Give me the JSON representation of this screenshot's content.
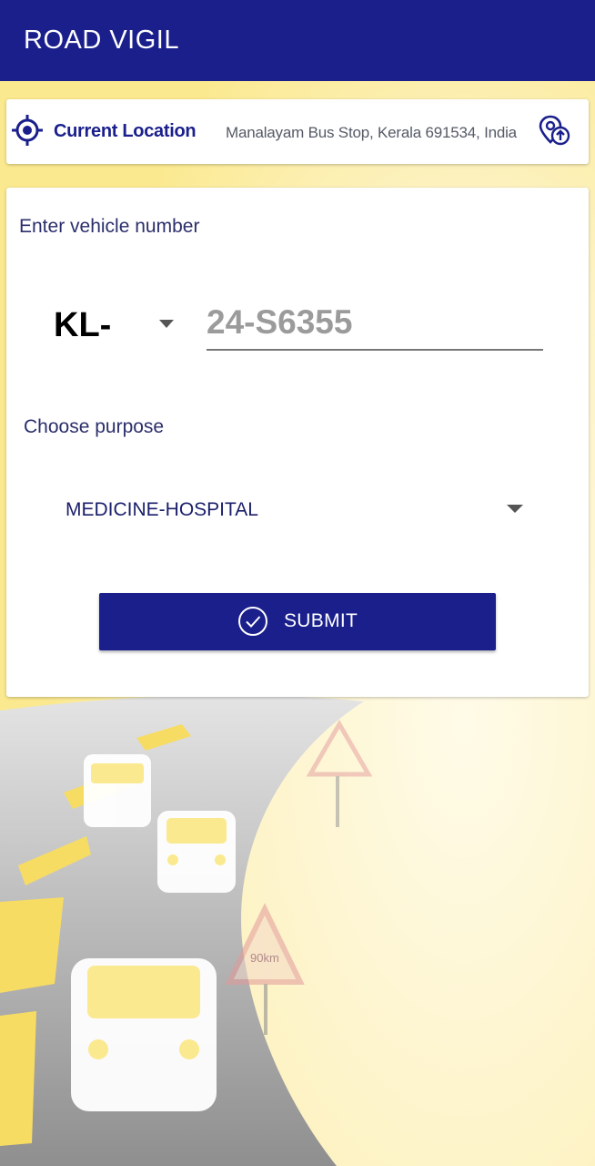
{
  "appbar": {
    "title": "ROAD VIGIL"
  },
  "location": {
    "label": "Current Location",
    "address": "Manalayam Bus Stop, Kerala 691534, India"
  },
  "form": {
    "vehicle_label": "Enter vehicle number",
    "state_prefix": "KL-",
    "vehicle_placeholder": "24-S6355",
    "vehicle_value": "",
    "purpose_label": "Choose purpose",
    "purpose_value": "MEDICINE-HOSPITAL",
    "submit_label": "SUBMIT"
  },
  "background": {
    "sign_text": "90km"
  },
  "colors": {
    "primary": "#1a1f8c",
    "background_yellow": "#fdf6cf",
    "road_gray": "#9a9a9a"
  },
  "icons": {
    "location": "crosshair-target-icon",
    "refresh_location": "location-upload-icon",
    "submit": "check-circle-icon",
    "dropdown": "caret-down-icon"
  }
}
